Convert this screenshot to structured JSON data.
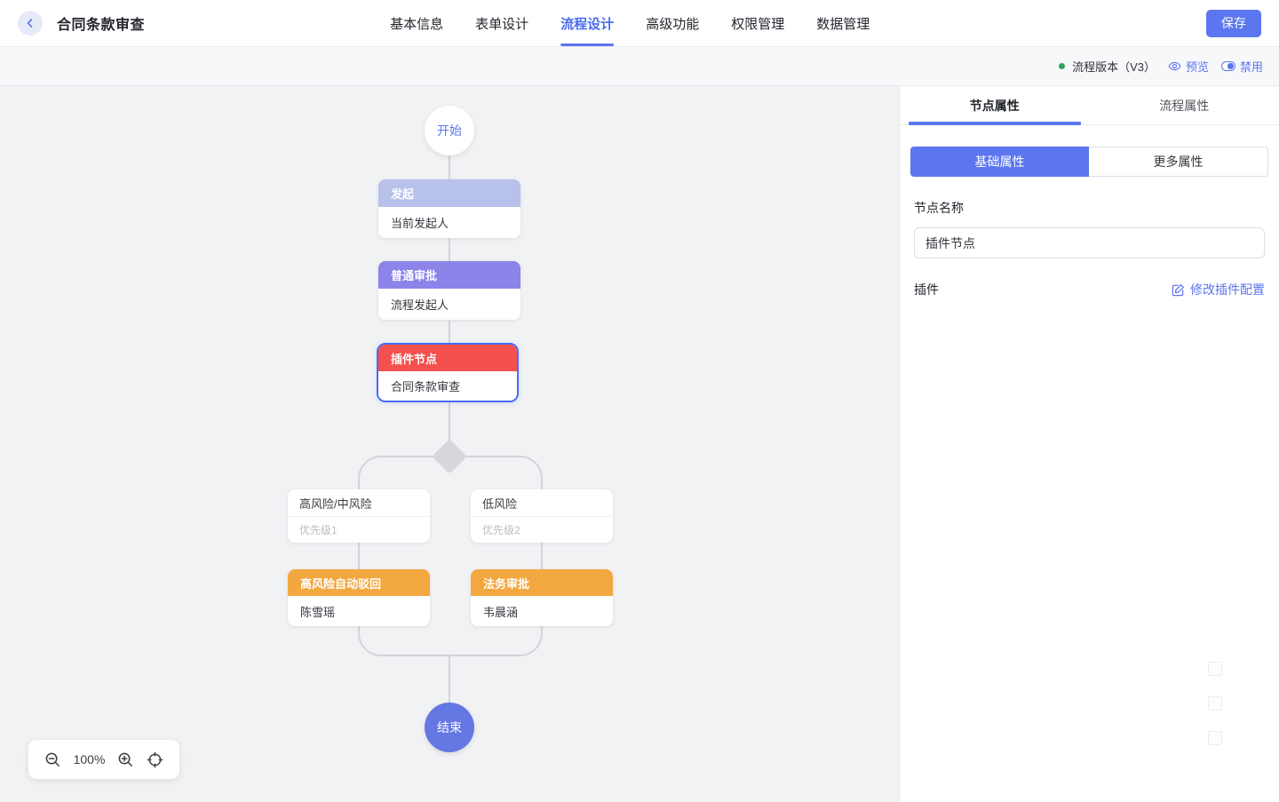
{
  "header": {
    "title": "合同条款审查",
    "back_icon": "chevron-left",
    "nav": [
      {
        "label": "基本信息",
        "active": false
      },
      {
        "label": "表单设计",
        "active": false
      },
      {
        "label": "流程设计",
        "active": true
      },
      {
        "label": "高级功能",
        "active": false
      },
      {
        "label": "权限管理",
        "active": false
      },
      {
        "label": "数据管理",
        "active": false
      }
    ],
    "save_label": "保存"
  },
  "toolbar": {
    "status_dot_color": "#2ba35f",
    "version_label": "流程版本（V3）",
    "preview_label": "预览",
    "preview_icon": "eye",
    "disable_label": "禁用",
    "disable_icon": "toggle-switch"
  },
  "canvas": {
    "start_label": "开始",
    "end_label": "结束",
    "nodes": [
      {
        "type": "initiator",
        "title": "发起",
        "body": "当前发起人",
        "header_color": "#b7c1ea",
        "selected": false
      },
      {
        "type": "approval",
        "title": "普通审批",
        "body": "流程发起人",
        "header_color": "#8c84e8",
        "selected": false
      },
      {
        "type": "plugin",
        "title": "插件节点",
        "body": "合同条款审查",
        "header_color": "#f5504d",
        "selected": true,
        "selected_border_color": "#4a6bf5"
      }
    ],
    "branches": [
      {
        "condition": "高风险/中风险",
        "priority": "优先级1",
        "node_title": "高风险自动驳回",
        "node_body": "陈雪瑶",
        "header_color": "#f3a73f"
      },
      {
        "condition": "低风险",
        "priority": "优先级2",
        "node_title": "法务审批",
        "node_body": "韦晨涵",
        "header_color": "#f3a73f"
      }
    ],
    "zoom": {
      "level": "100%",
      "zoom_out_icon": "magnifier-minus",
      "zoom_in_icon": "magnifier-plus",
      "reset_icon": "crosshair-target"
    }
  },
  "panel": {
    "tabs": [
      {
        "label": "节点属性",
        "active": true
      },
      {
        "label": "流程属性",
        "active": false
      }
    ],
    "sub_tabs": [
      {
        "label": "基础属性",
        "active": true
      },
      {
        "label": "更多属性",
        "active": false
      }
    ],
    "fields": {
      "node_name_label": "节点名称",
      "node_name_value": "插件节点",
      "plugin_label": "插件",
      "plugin_action_label": "修改插件配置",
      "plugin_action_icon": "pencil-square"
    }
  },
  "colors": {
    "accent_blue": "#5b74ee",
    "nav_active_blue": "#4a6bf0",
    "canvas_bg": "#f1f2f4",
    "line_gray": "#d3d4d8",
    "end_circle_blue": "#6577e2",
    "orange": "#f3a73f",
    "red": "#f5504d",
    "purple": "#8c84e8",
    "light_periwinkle": "#b7c1ea"
  }
}
